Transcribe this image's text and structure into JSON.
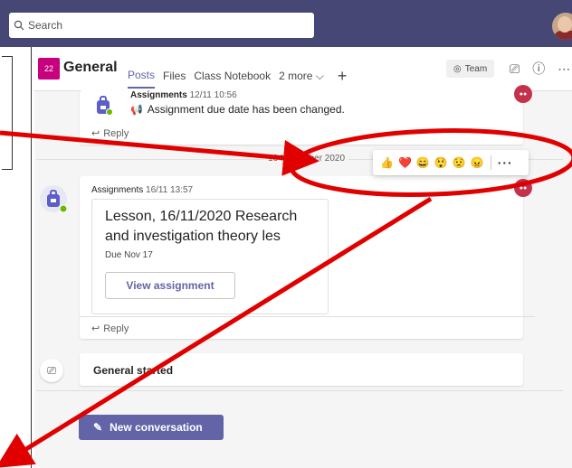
{
  "topbar": {
    "search_placeholder": "Search"
  },
  "channel": {
    "team_tile": "22",
    "name": "General",
    "tabs": [
      "Posts",
      "Files",
      "Class Notebook",
      "2 more"
    ],
    "team_button": "Team"
  },
  "post1": {
    "sender": "Assignments",
    "time": "12/11 10:56",
    "text": "Assignment due date has been changed.",
    "reply": "Reply"
  },
  "date_divider": "16 November 2020",
  "reactions": [
    "👍",
    "❤️",
    "😄",
    "😲",
    "😟",
    "😠"
  ],
  "post2": {
    "sender": "Assignments",
    "time": "16/11 13:57",
    "title": "Lesson, 16/11/2020 Research and investigation theory les",
    "due": "Due Nov 17",
    "button": "View assignment",
    "reply": "Reply"
  },
  "meeting": {
    "label": "General started"
  },
  "new_conversation": "New conversation",
  "colors": {
    "topbar": "#464775",
    "accent": "#6264a7",
    "annotation": "#e00000"
  }
}
